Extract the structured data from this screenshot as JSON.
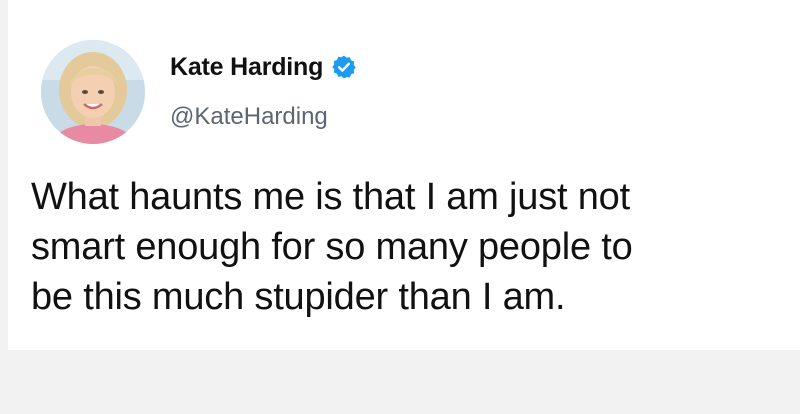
{
  "author": {
    "display_name": "Kate Harding",
    "handle": "@KateHarding",
    "verified": true,
    "avatar": "profile-photo"
  },
  "tweet": {
    "text": "What haunts me is that I am just not\nsmart enough for so many people to\nbe this much stupider than I am."
  },
  "colors": {
    "verified_badge": "#1d9bf0",
    "name_text": "#111111",
    "handle_text": "#5b6670",
    "background": "#ffffff",
    "page_background": "#f2f2f2"
  }
}
